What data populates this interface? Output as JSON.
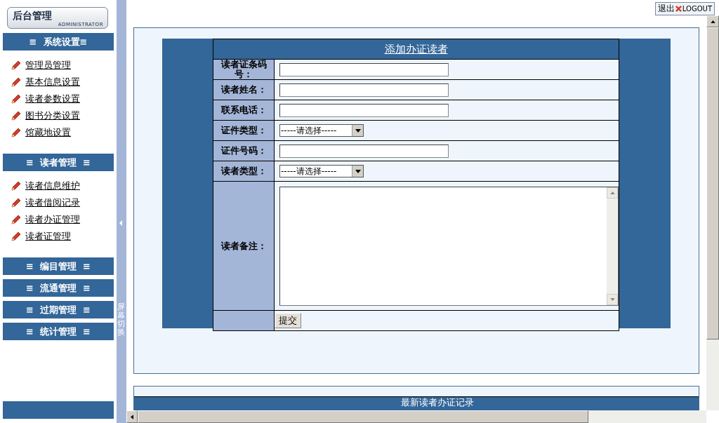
{
  "logo": {
    "title": "后台管理",
    "subtitle": "ADMINISTRATOR"
  },
  "sidebar": {
    "sections": [
      {
        "title": "≡  系统设置≡",
        "items": [
          "管理员管理",
          "基本信息设置",
          "读者参数设置",
          "图书分类设置",
          "馆藏地设置"
        ]
      },
      {
        "title": "≡  读者管理  ≡",
        "items": [
          "读者信息维护",
          "读者借阅记录",
          "读者办证管理",
          "读者证管理"
        ]
      },
      {
        "title": "≡  编目管理  ≡"
      },
      {
        "title": "≡  流通管理  ≡"
      },
      {
        "title": "≡  过期管理  ≡"
      },
      {
        "title": "≡  统计管理  ≡"
      }
    ]
  },
  "toggle": {
    "label": "屏幕切换"
  },
  "logout": {
    "label": "退出",
    "label_en": "LOGOUT"
  },
  "form": {
    "title": "添加办证读者",
    "fields": [
      {
        "kind": "text",
        "label": "读者证条码号："
      },
      {
        "kind": "text",
        "label": "读者姓名："
      },
      {
        "kind": "text",
        "label": "联系电话："
      },
      {
        "kind": "select",
        "label": "证件类型：",
        "value": "-----请选择-----"
      },
      {
        "kind": "text",
        "label": "证件号码："
      },
      {
        "kind": "select",
        "label": "读者类型：",
        "value": "-----请选择-----"
      },
      {
        "kind": "textarea",
        "label": "读者备注："
      }
    ],
    "submit": "提交"
  },
  "recent": {
    "title": "最新读者办证记录"
  }
}
